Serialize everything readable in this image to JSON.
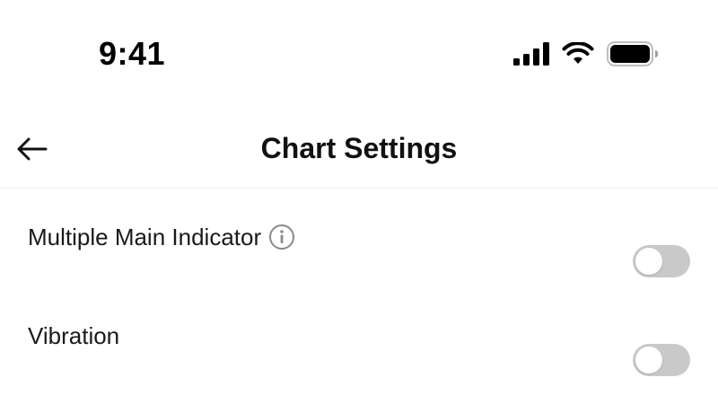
{
  "status_bar": {
    "time": "9:41",
    "icons": [
      "signal-icon",
      "wifi-icon",
      "battery-icon"
    ]
  },
  "header": {
    "back_icon": "back-arrow-icon",
    "title": "Chart Settings"
  },
  "settings": [
    {
      "label": "Multiple Main Indicator",
      "has_info": true,
      "enabled": false
    },
    {
      "label": "Vibration",
      "has_info": false,
      "enabled": false
    }
  ],
  "colors": {
    "toggle_off": "#c9c9c9",
    "text": "#111111",
    "divider": "#ececec"
  }
}
